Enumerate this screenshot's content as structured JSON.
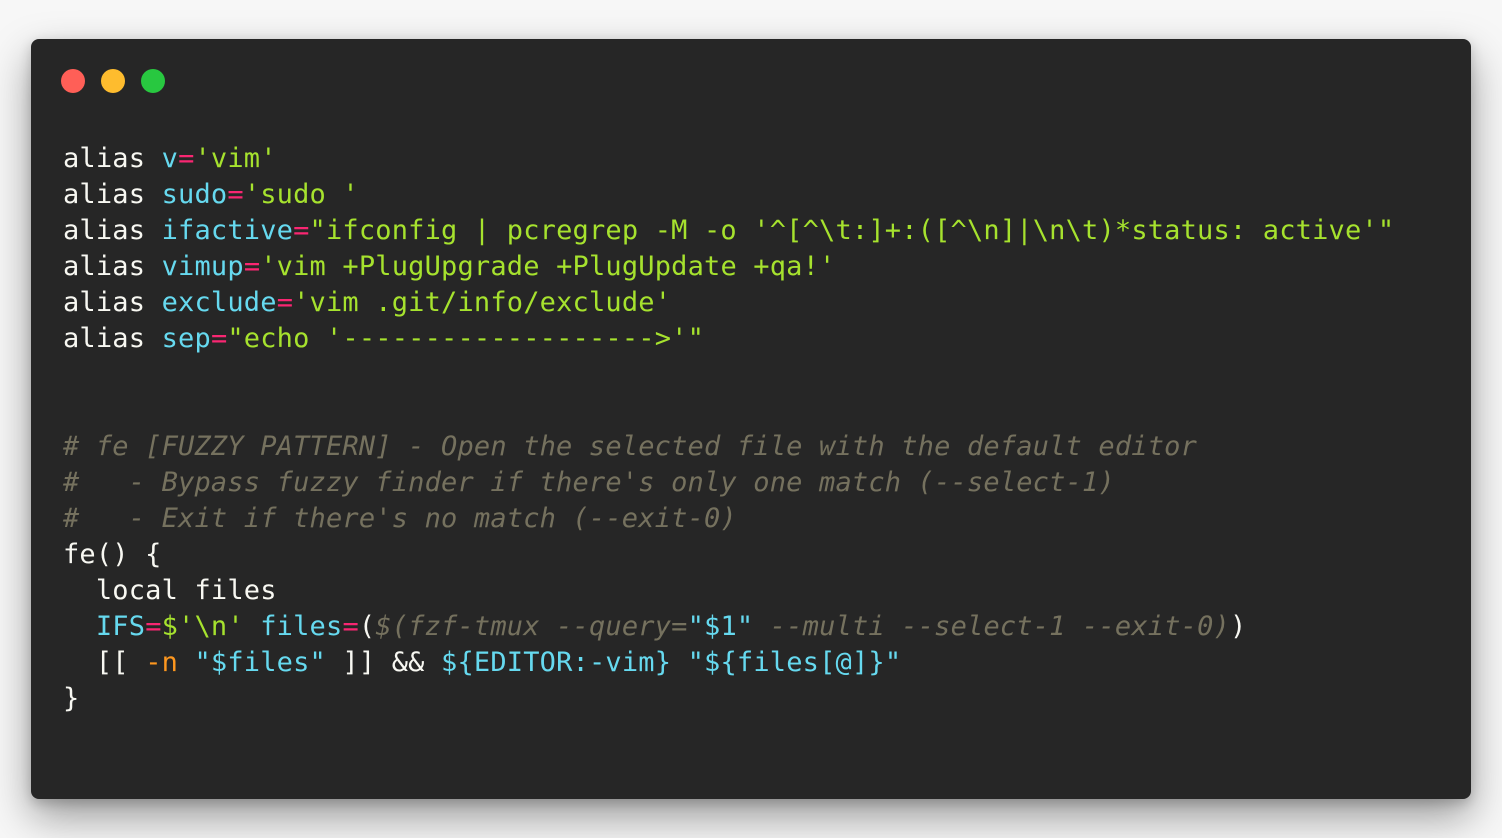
{
  "window": {
    "buttons": [
      {
        "name": "close",
        "color": "#ff5f57"
      },
      {
        "name": "minimize",
        "color": "#febc2e"
      },
      {
        "name": "zoom",
        "color": "#28c840"
      }
    ]
  },
  "colors": {
    "background": "#262626",
    "text": "#f8f8f2",
    "variable": "#66d9ef",
    "operator": "#f92672",
    "string": "#a6e22e",
    "comment": "#75715e",
    "option": "#fd971f"
  },
  "code": {
    "lines": [
      {
        "tokens": [
          {
            "text": "alias ",
            "style": "text"
          },
          {
            "text": "v",
            "style": "variable"
          },
          {
            "text": "=",
            "style": "operator"
          },
          {
            "text": "'vim'",
            "style": "string"
          }
        ]
      },
      {
        "tokens": [
          {
            "text": "alias ",
            "style": "text"
          },
          {
            "text": "sudo",
            "style": "variable"
          },
          {
            "text": "=",
            "style": "operator"
          },
          {
            "text": "'sudo '",
            "style": "string"
          }
        ]
      },
      {
        "tokens": [
          {
            "text": "alias ",
            "style": "text"
          },
          {
            "text": "ifactive",
            "style": "variable"
          },
          {
            "text": "=",
            "style": "operator"
          },
          {
            "text": "\"ifconfig | pcregrep -M -o '^[^\\t:]+:([^\\n]|\\n\\t)*status: active'\"",
            "style": "string"
          }
        ]
      },
      {
        "tokens": [
          {
            "text": "alias ",
            "style": "text"
          },
          {
            "text": "vimup",
            "style": "variable"
          },
          {
            "text": "=",
            "style": "operator"
          },
          {
            "text": "'vim +PlugUpgrade +PlugUpdate +qa!'",
            "style": "string"
          }
        ]
      },
      {
        "tokens": [
          {
            "text": "alias ",
            "style": "text"
          },
          {
            "text": "exclude",
            "style": "variable"
          },
          {
            "text": "=",
            "style": "operator"
          },
          {
            "text": "'vim .git/info/exclude'",
            "style": "string"
          }
        ]
      },
      {
        "tokens": [
          {
            "text": "alias ",
            "style": "text"
          },
          {
            "text": "sep",
            "style": "variable"
          },
          {
            "text": "=",
            "style": "operator"
          },
          {
            "text": "\"echo '------------------->'\"",
            "style": "string"
          }
        ]
      },
      {
        "tokens": []
      },
      {
        "tokens": []
      },
      {
        "tokens": [
          {
            "text": "# fe [FUZZY PATTERN] - Open the selected file with the default editor",
            "style": "comment"
          }
        ]
      },
      {
        "tokens": [
          {
            "text": "#   - Bypass fuzzy finder if there's only one match (--select-1)",
            "style": "comment"
          }
        ]
      },
      {
        "tokens": [
          {
            "text": "#   - Exit if there's no match (--exit-0)",
            "style": "comment"
          }
        ]
      },
      {
        "tokens": [
          {
            "text": "fe() {",
            "style": "text"
          }
        ]
      },
      {
        "tokens": [
          {
            "text": "  local files",
            "style": "text"
          }
        ]
      },
      {
        "tokens": [
          {
            "text": "  ",
            "style": "text"
          },
          {
            "text": "IFS",
            "style": "variable"
          },
          {
            "text": "=",
            "style": "operator"
          },
          {
            "text": "$'\\n'",
            "style": "string"
          },
          {
            "text": " ",
            "style": "text"
          },
          {
            "text": "files",
            "style": "variable"
          },
          {
            "text": "=",
            "style": "operator"
          },
          {
            "text": "(",
            "style": "text"
          },
          {
            "text": "$(fzf-tmux --query=",
            "style": "comment"
          },
          {
            "text": "\"$1\"",
            "style": "variable"
          },
          {
            "text": " --multi --select-1 --exit-0)",
            "style": "comment"
          },
          {
            "text": ")",
            "style": "text"
          }
        ]
      },
      {
        "tokens": [
          {
            "text": "  [[ ",
            "style": "text"
          },
          {
            "text": "-n",
            "style": "option"
          },
          {
            "text": " ",
            "style": "text"
          },
          {
            "text": "\"$files\"",
            "style": "variable"
          },
          {
            "text": " ]] && ",
            "style": "text"
          },
          {
            "text": "${EDITOR:-vim}",
            "style": "variable"
          },
          {
            "text": " ",
            "style": "text"
          },
          {
            "text": "\"${files[@]}\"",
            "style": "variable"
          }
        ]
      },
      {
        "tokens": [
          {
            "text": "}",
            "style": "text"
          }
        ]
      }
    ]
  }
}
